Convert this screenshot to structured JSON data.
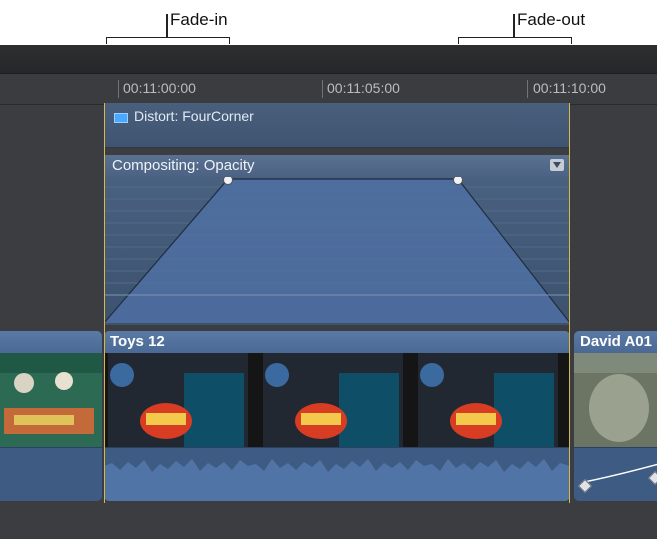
{
  "callouts": {
    "fade_in": "Fade-in",
    "fade_out": "Fade-out"
  },
  "ruler": {
    "timecodes": [
      "00:11:00:00",
      "00:11:05:00",
      "00:11:10:00"
    ]
  },
  "effects": {
    "distort_label": "Distort: FourCorner",
    "opacity_label": "Compositing: Opacity"
  },
  "clips": {
    "main_title": "Toys 12",
    "next_title": "David A01"
  },
  "colors": {
    "selection": "#d8b84a",
    "clip_blue": "#4a6994",
    "effect_blue": "#3f5676"
  },
  "icons": [
    "distort-swatch-icon",
    "effect-menu-icon",
    "fade-handle-icon",
    "keyframe-icon"
  ]
}
